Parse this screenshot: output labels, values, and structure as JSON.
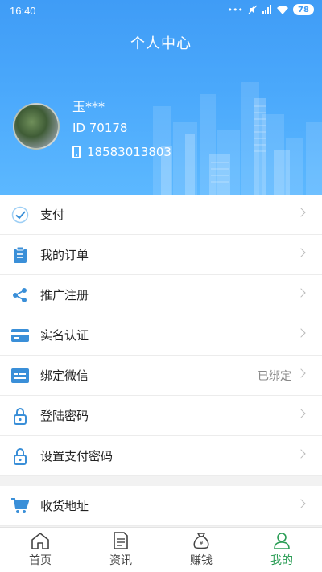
{
  "status": {
    "time": "16:40",
    "battery": "78"
  },
  "header": {
    "title": "个人中心"
  },
  "profile": {
    "name": "玉***",
    "id": "ID 70178",
    "phone": "18583013803"
  },
  "menu": [
    {
      "label": "支付",
      "icon": "check-circle-icon"
    },
    {
      "label": "我的订单",
      "icon": "clipboard-icon"
    },
    {
      "label": "推广注册",
      "icon": "share-icon"
    },
    {
      "label": "实名认证",
      "icon": "card-icon"
    },
    {
      "label": "绑定微信",
      "icon": "wechat-icon",
      "status": "已绑定"
    },
    {
      "label": "登陆密码",
      "icon": "lock-icon"
    },
    {
      "label": "设置支付密码",
      "icon": "lock-icon"
    }
  ],
  "menu2": [
    {
      "label": "收货地址",
      "icon": "cart-icon"
    }
  ],
  "nav": [
    {
      "label": "首页",
      "icon": "home-icon"
    },
    {
      "label": "资讯",
      "icon": "news-icon"
    },
    {
      "label": "赚钱",
      "icon": "money-bag-icon"
    },
    {
      "label": "我的",
      "icon": "user-icon",
      "active": true
    }
  ],
  "colors": {
    "header_blue": "#4aa8fb",
    "icon_blue": "#3a8fd8",
    "active_green": "#2a9d55"
  }
}
